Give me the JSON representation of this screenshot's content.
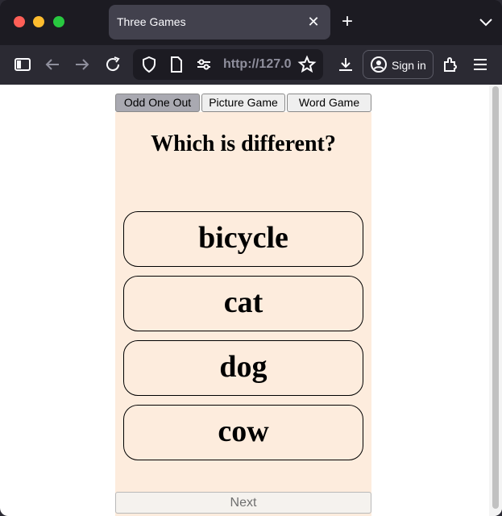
{
  "browser": {
    "tab_title": "Three Games",
    "url": "http://127.0",
    "sign_in_label": "Sign in"
  },
  "game_tabs": [
    {
      "label": "Odd One Out",
      "active": true
    },
    {
      "label": "Picture Game",
      "active": false
    },
    {
      "label": "Word Game",
      "active": false
    }
  ],
  "game": {
    "question": "Which is different?",
    "options": [
      "bicycle",
      "cat",
      "dog",
      "cow"
    ],
    "next_label": "Next"
  },
  "colors": {
    "panel_bg": "#fdecdd",
    "active_tab_bg": "#a9a9b1"
  }
}
